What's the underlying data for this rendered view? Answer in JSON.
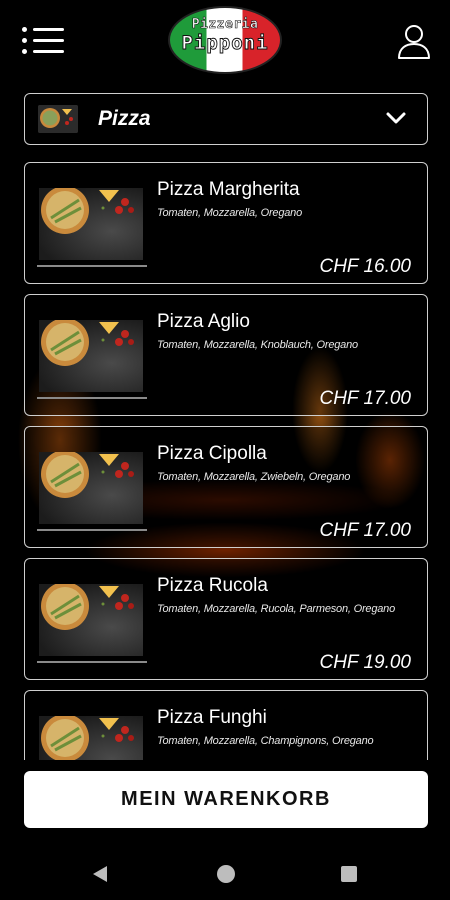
{
  "header": {
    "logo_line1": "Pizzeria",
    "logo_line2": "Pipponi",
    "menu_icon": "hamburger-menu-icon",
    "user_icon": "user-profile-icon"
  },
  "category": {
    "label": "Pizza",
    "icon": "chevron-down-icon"
  },
  "items": [
    {
      "name": "Pizza Margherita",
      "description": "Tomaten, Mozzarella, Oregano",
      "price": "CHF 16.00"
    },
    {
      "name": "Pizza Aglio",
      "description": "Tomaten, Mozzarella, Knoblauch, Oregano",
      "price": "CHF 17.00"
    },
    {
      "name": "Pizza Cipolla",
      "description": "Tomaten, Mozzarella, Zwiebeln, Oregano",
      "price": "CHF 17.00"
    },
    {
      "name": "Pizza Rucola",
      "description": "Tomaten, Mozzarella, Rucola, Parmeson, Oregano",
      "price": "CHF 19.00"
    },
    {
      "name": "Pizza Funghi",
      "description": "Tomaten, Mozzarella, Champignons, Oregano",
      "price": ""
    }
  ],
  "cart": {
    "label": "MEIN WARENKORB"
  },
  "navbar": {
    "back_icon": "back-triangle-icon",
    "home_icon": "home-circle-icon",
    "recent_icon": "recent-apps-square-icon"
  },
  "colors": {
    "background": "#000000",
    "border": "#cfcfcf",
    "button": "#ffffff",
    "flag_green": "#1f9b3a",
    "flag_red": "#d8232a"
  }
}
